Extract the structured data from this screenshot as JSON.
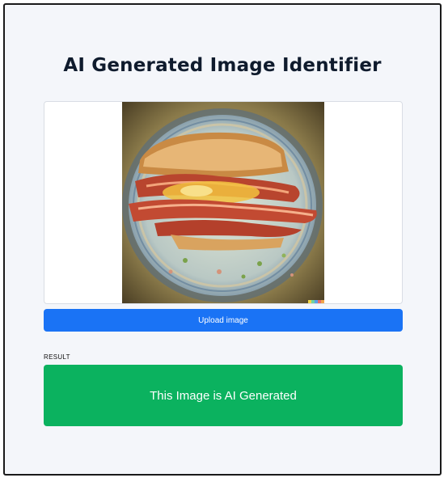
{
  "app": {
    "title": "AI Generated Image Identifier"
  },
  "preview": {
    "image_description_icon": "uploaded-image",
    "watermark_colors": [
      "#f2d64a",
      "#6fd3a3",
      "#5aa0e8",
      "#e86a6a",
      "#f0a54a"
    ]
  },
  "actions": {
    "upload_label": "Upload image"
  },
  "result": {
    "label": "RESULT",
    "text": "This Image is AI Generated",
    "color": "#0bb25f"
  },
  "colors": {
    "primary": "#1a73f5",
    "success": "#0bb25f",
    "background": "#f4f6fa"
  }
}
